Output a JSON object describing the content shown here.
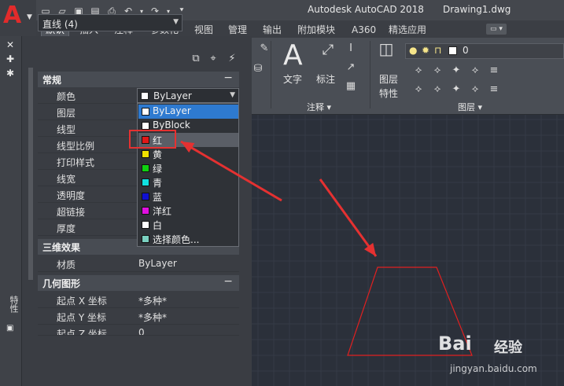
{
  "titlebar": {
    "app_title": "Autodesk AutoCAD 2018",
    "doc_title": "Drawing1.dwg",
    "app_logo": "A"
  },
  "ribbon_tabs": [
    "默认",
    "插入",
    "注释",
    "参数化",
    "视图",
    "管理",
    "输出",
    "附加模块",
    "A360",
    "精选应用"
  ],
  "ribbon": {
    "text_label": "文字",
    "dim_label": "标注",
    "annotation_group": "注释 ▾",
    "layer_props_label_1": "图层",
    "layer_props_label_2": "特性",
    "layers_group": "图层 ▾",
    "layer_value": "0"
  },
  "palette": {
    "strip_title": "特性",
    "object_combo": "直线 (4)",
    "sections": {
      "general": "常规",
      "three_d": "三维效果",
      "geometry": "几何图形"
    },
    "general_rows": [
      {
        "key": "颜色",
        "value": ""
      },
      {
        "key": "图层",
        "value": ""
      },
      {
        "key": "线型",
        "value": ""
      },
      {
        "key": "线型比例",
        "value": ""
      },
      {
        "key": "打印样式",
        "value": ""
      },
      {
        "key": "线宽",
        "value": ""
      },
      {
        "key": "透明度",
        "value": ""
      },
      {
        "key": "超链接",
        "value": ""
      },
      {
        "key": "厚度",
        "value": ""
      }
    ],
    "material_row": {
      "key": "材质",
      "value": "ByLayer"
    },
    "geometry_rows": [
      {
        "key": "起点 X 坐标",
        "value": "*多种*"
      },
      {
        "key": "起点 Y 坐标",
        "value": "*多种*"
      },
      {
        "key": "起点 Z 坐标",
        "value": "0"
      }
    ]
  },
  "color_dropdown": {
    "current": "ByLayer",
    "items": [
      {
        "label": "ByLayer",
        "color": "#ffffff",
        "state": "selected"
      },
      {
        "label": "ByBlock",
        "color": "#ffffff",
        "state": ""
      },
      {
        "label": "红",
        "color": "#e01818",
        "state": "hover"
      },
      {
        "label": "黄",
        "color": "#f0e000",
        "state": ""
      },
      {
        "label": "绿",
        "color": "#10d010",
        "state": ""
      },
      {
        "label": "青",
        "color": "#10e0e0",
        "state": ""
      },
      {
        "label": "蓝",
        "color": "#1010d0",
        "state": ""
      },
      {
        "label": "洋红",
        "color": "#e010e0",
        "state": ""
      },
      {
        "label": "白",
        "color": "#ffffff",
        "state": ""
      },
      {
        "label": "选择颜色...",
        "color": "#7ad0c0",
        "state": ""
      }
    ]
  },
  "canvas": {
    "shape_color": "#e02020",
    "arrow_color": "#e53131"
  },
  "watermark": {
    "logo": "Bai 经验",
    "url": "jingyan.baidu.com"
  }
}
